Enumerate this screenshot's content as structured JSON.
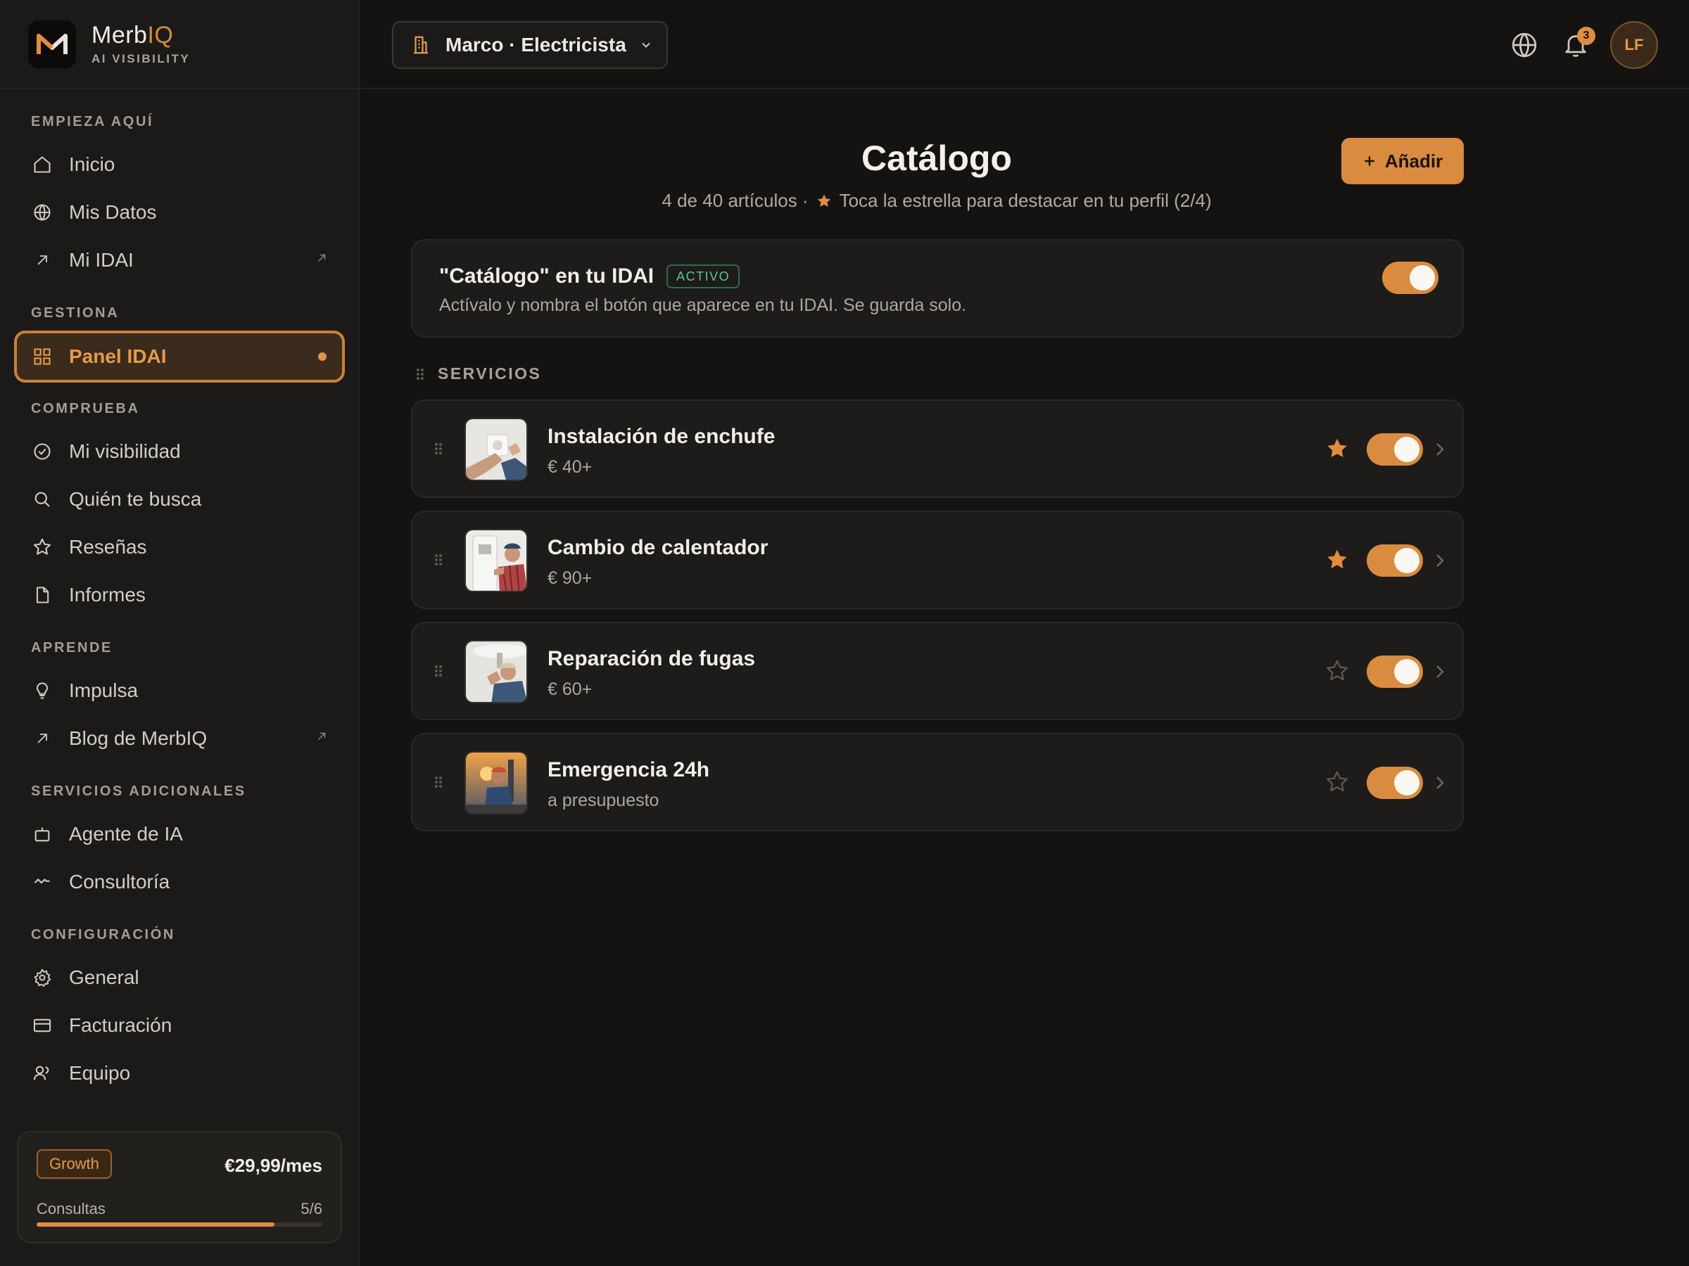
{
  "brand": {
    "name_main": "Merb",
    "name_accent": "IQ",
    "subtitle": "AI VISIBILITY"
  },
  "sidebar": {
    "sections": [
      {
        "label": "EMPIEZA AQUÍ",
        "items": [
          {
            "label": "Inicio",
            "icon": "home-icon"
          },
          {
            "label": "Mis Datos",
            "icon": "globe-icon"
          },
          {
            "label": "Mi IDAI",
            "icon": "arrow-up-right-icon",
            "external": true
          }
        ]
      },
      {
        "label": "GESTIONA",
        "items": [
          {
            "label": "Panel IDAI",
            "icon": "grid-icon",
            "active": true
          }
        ]
      },
      {
        "label": "COMPRUEBA",
        "items": [
          {
            "label": "Mi visibilidad",
            "icon": "check-circle-icon"
          },
          {
            "label": "Quién te busca",
            "icon": "search-icon"
          },
          {
            "label": "Reseñas",
            "icon": "star-icon"
          },
          {
            "label": "Informes",
            "icon": "file-icon"
          }
        ]
      },
      {
        "label": "APRENDE",
        "items": [
          {
            "label": "Impulsa",
            "icon": "lightbulb-icon"
          },
          {
            "label": "Blog de MerbIQ",
            "icon": "arrow-up-right-icon",
            "external": true
          }
        ]
      },
      {
        "label": "SERVICIOS ADICIONALES",
        "items": [
          {
            "label": "Agente de IA",
            "icon": "bot-icon"
          },
          {
            "label": "Consultoría",
            "icon": "activity-icon"
          }
        ]
      },
      {
        "label": "CONFIGURACIÓN",
        "items": [
          {
            "label": "General",
            "icon": "gear-icon"
          },
          {
            "label": "Facturación",
            "icon": "credit-card-icon"
          },
          {
            "label": "Equipo",
            "icon": "users-icon"
          }
        ]
      }
    ],
    "plan": {
      "name": "Growth",
      "price": "€29,99/mes",
      "metric_label": "Consultas",
      "metric_value": "5/6",
      "progress": 0.833
    }
  },
  "topbar": {
    "business": "Marco · Electricista",
    "notifications_count": "3",
    "avatar_initials": "LF"
  },
  "main": {
    "title": "Catálogo",
    "subtitle_count": "4 de 40 artículos ·",
    "subtitle_hint": "Toca la estrella para destacar en tu perfil (2/4)",
    "add_button": "Añadir",
    "toggle_card": {
      "title": "\"Catálogo\" en tu IDAI",
      "status": "ACTIVO",
      "description": "Actívalo y nombra el botón que aparece en tu IDAI. Se guarda solo.",
      "enabled": true
    },
    "group_label": "SERVICIOS",
    "items": [
      {
        "name": "Instalación de enchufe",
        "price": "€ 40+",
        "featured": true,
        "enabled": true
      },
      {
        "name": "Cambio de calentador",
        "price": "€ 90+",
        "featured": true,
        "enabled": true
      },
      {
        "name": "Reparación de fugas",
        "price": "€ 60+",
        "featured": false,
        "enabled": true
      },
      {
        "name": "Emergencia 24h",
        "price": "a presupuesto",
        "featured": false,
        "enabled": true
      }
    ]
  },
  "colors": {
    "accent": "#d98b3f",
    "background": "#141312",
    "sidebar": "#1b1a18",
    "success": "#5ec48b"
  }
}
